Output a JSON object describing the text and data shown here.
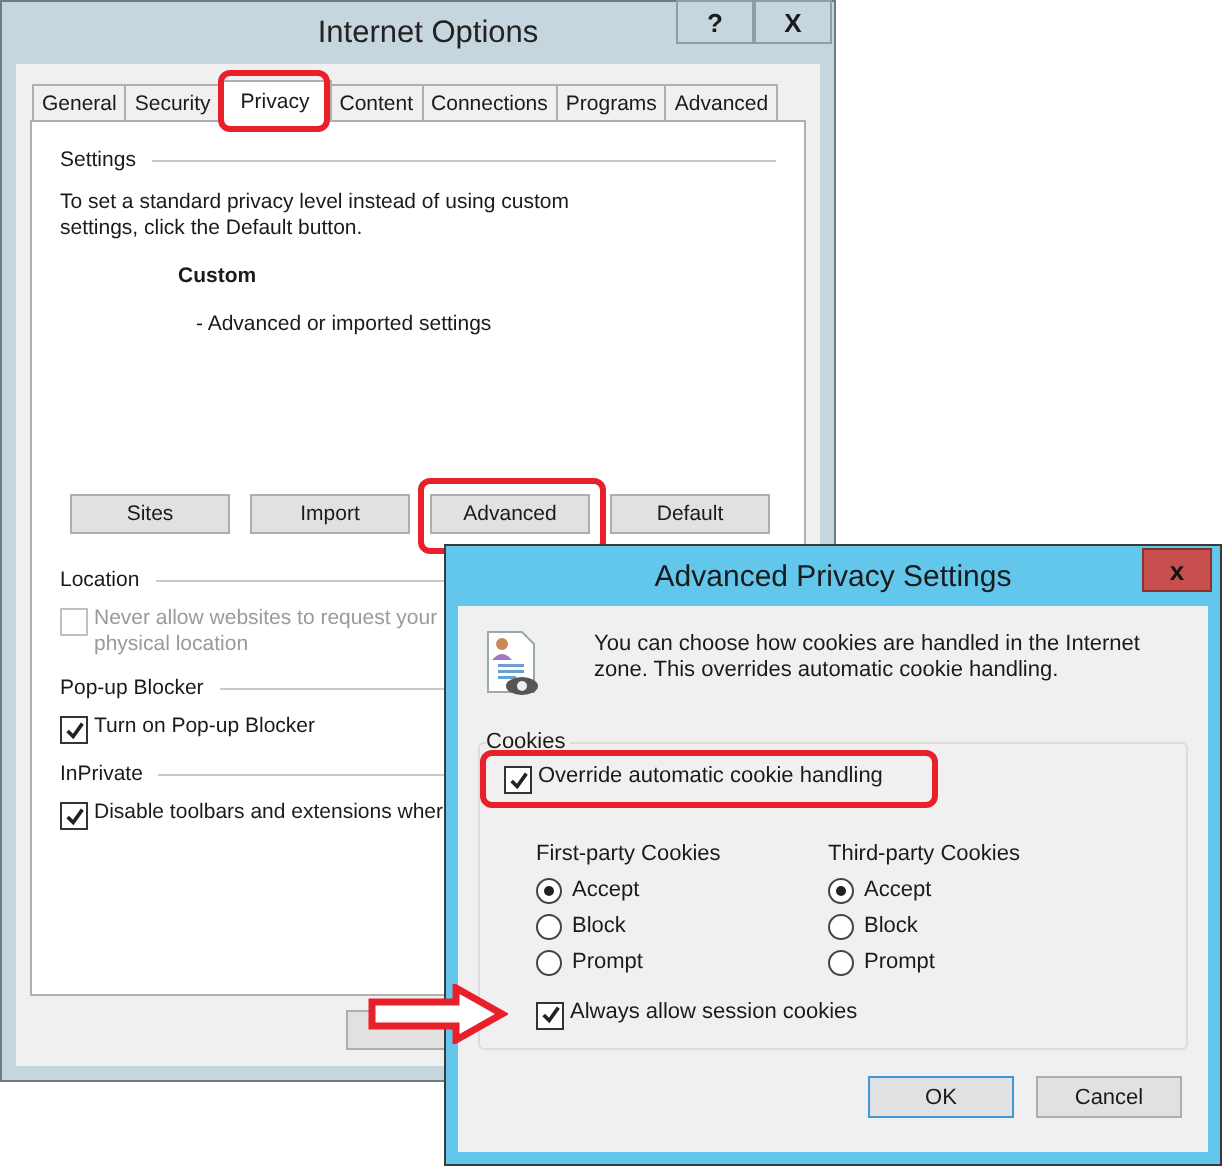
{
  "main_window": {
    "title": "Internet Options",
    "title_buttons": [
      "?",
      "X"
    ],
    "tabs": [
      {
        "label": "General",
        "selected": false,
        "highlighted": false
      },
      {
        "label": "Security",
        "selected": false,
        "highlighted": false
      },
      {
        "label": "Privacy",
        "selected": true,
        "highlighted": true
      },
      {
        "label": "Content",
        "selected": false,
        "highlighted": false
      },
      {
        "label": "Connections",
        "selected": false,
        "highlighted": false
      },
      {
        "label": "Programs",
        "selected": false,
        "highlighted": false
      },
      {
        "label": "Advanced",
        "selected": false,
        "highlighted": false
      }
    ],
    "settings": {
      "heading": "Settings",
      "description": "To set a standard privacy level instead of using custom settings, click the Default button.",
      "level_name": "Custom",
      "level_detail": "- Advanced or imported settings",
      "buttons": [
        {
          "label": "Sites",
          "highlighted": false
        },
        {
          "label": "Import",
          "highlighted": false
        },
        {
          "label": "Advanced",
          "highlighted": true
        },
        {
          "label": "Default",
          "highlighted": false
        }
      ]
    },
    "sections": [
      {
        "heading": "Location",
        "options": [
          {
            "label": "Never allow websites to request your physical location",
            "checked": false,
            "disabled": true
          }
        ]
      },
      {
        "heading": "Pop-up Blocker",
        "options": [
          {
            "label": "Turn on Pop-up Blocker",
            "checked": true,
            "disabled": false
          }
        ]
      },
      {
        "heading": "InPrivate",
        "options": [
          {
            "label": "Disable toolbars and extensions wher",
            "checked": true,
            "disabled": false
          }
        ]
      }
    ]
  },
  "dialog": {
    "title": "Advanced Privacy Settings",
    "close": "x",
    "description": "You can choose how cookies are handled in the Internet zone.  This overrides automatic cookie handling.",
    "group": "Cookies",
    "override": {
      "label": "Override automatic cookie handling",
      "checked": true,
      "highlighted": true
    },
    "columns": [
      {
        "heading": "First-party Cookies",
        "options": [
          {
            "label": "Accept",
            "selected": true
          },
          {
            "label": "Block",
            "selected": false
          },
          {
            "label": "Prompt",
            "selected": false
          }
        ]
      },
      {
        "heading": "Third-party Cookies",
        "options": [
          {
            "label": "Accept",
            "selected": true
          },
          {
            "label": "Block",
            "selected": false
          },
          {
            "label": "Prompt",
            "selected": false
          }
        ]
      }
    ],
    "session": {
      "label": "Always allow session cookies",
      "checked": true,
      "arrow": true
    },
    "buttons": [
      {
        "label": "OK",
        "default": true
      },
      {
        "label": "Cancel",
        "default": false
      }
    ]
  }
}
